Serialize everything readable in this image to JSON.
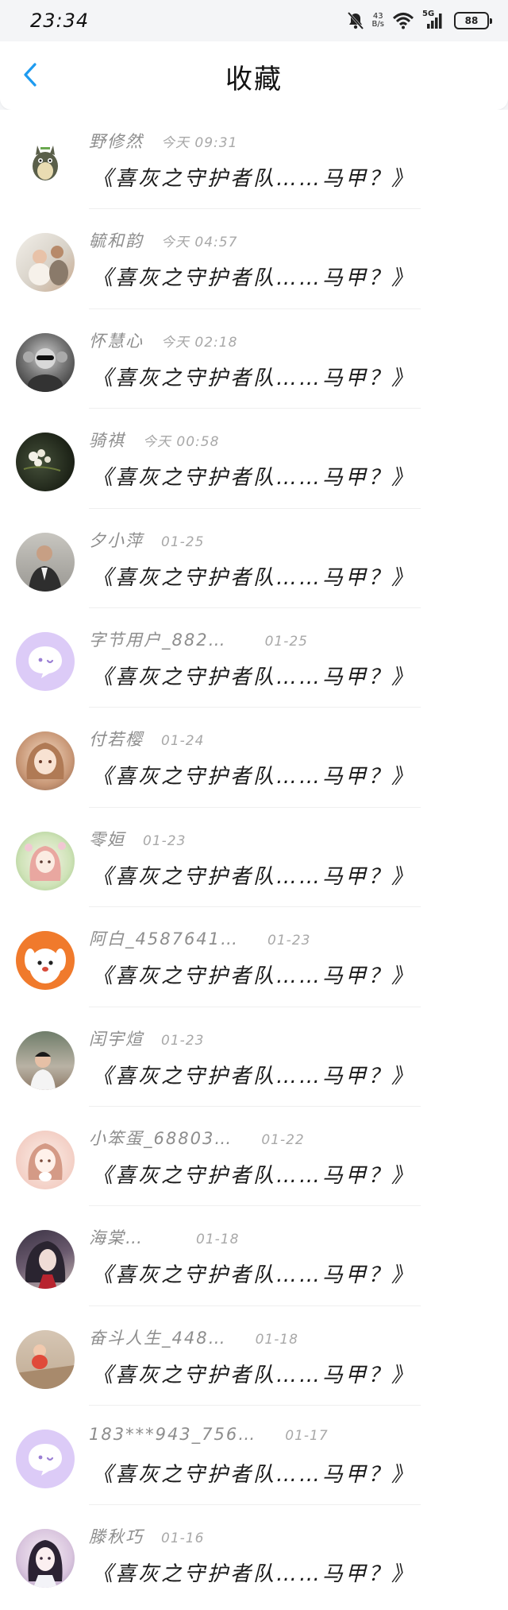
{
  "status": {
    "time": "23:34",
    "net_speed_top": "43",
    "net_speed_bottom": "B/s",
    "network": "5G",
    "battery": "88"
  },
  "header": {
    "title": "收藏"
  },
  "items": [
    {
      "name": "野修然",
      "time": "今天 09:31",
      "message": "《喜灰之守护者队……马甲？》",
      "avatar": "totoro"
    },
    {
      "name": "毓和韵",
      "time": "今天 04:57",
      "message": "《喜灰之守护者队……马甲？》",
      "avatar": "photo-child"
    },
    {
      "name": "怀慧心",
      "time": "今天 02:18",
      "message": "《喜灰之守护者队……马甲？》",
      "avatar": "photo-bw"
    },
    {
      "name": "骑祺",
      "time": "今天 00:58",
      "message": "《喜灰之守护者队……马甲？》",
      "avatar": "photo-flowers"
    },
    {
      "name": "夕小萍",
      "time": "01-25",
      "message": "《喜灰之守护者队……马甲？》",
      "avatar": "photo-man"
    },
    {
      "name": "字节用户_882…",
      "time": "01-25",
      "message": "《喜灰之守护者队……马甲？》",
      "avatar": "default-purple"
    },
    {
      "name": "付若樱",
      "time": "01-24",
      "message": "《喜灰之守护者队……马甲？》",
      "avatar": "anime-girl"
    },
    {
      "name": "零姮",
      "time": "01-23",
      "message": "《喜灰之守护者队……马甲？》",
      "avatar": "anime-green"
    },
    {
      "name": "阿白_4587641…",
      "time": "01-23",
      "message": "《喜灰之守护者队……马甲？》",
      "avatar": "cartoon-dog"
    },
    {
      "name": "闰宇煊",
      "time": "01-23",
      "message": "《喜灰之守护者队……马甲？》",
      "avatar": "photo-kid"
    },
    {
      "name": "小笨蛋_68803…",
      "time": "01-22",
      "message": "《喜灰之守护者队……马甲？》",
      "avatar": "anime-pink"
    },
    {
      "name": "海棠…",
      "time": "01-18",
      "message": "《喜灰之守护者队……马甲？》",
      "avatar": "anime-dark"
    },
    {
      "name": "奋斗人生_448…",
      "time": "01-18",
      "message": "《喜灰之守护者队……马甲？》",
      "avatar": "photo-baby"
    },
    {
      "name": "183***943_756…",
      "time": "01-17",
      "message": "《喜灰之守护者队……马甲？》",
      "avatar": "default-purple"
    },
    {
      "name": "滕秋巧",
      "time": "01-16",
      "message": "《喜灰之守护者队……马甲？》",
      "avatar": "anime-hanfu"
    }
  ],
  "colors": {
    "accent": "#1e9bf0",
    "name_text": "#8d8d8d",
    "time_text": "#a8a8a8",
    "message_text": "#1a1a1a",
    "default_avatar_bg": "#d9c7f7"
  }
}
